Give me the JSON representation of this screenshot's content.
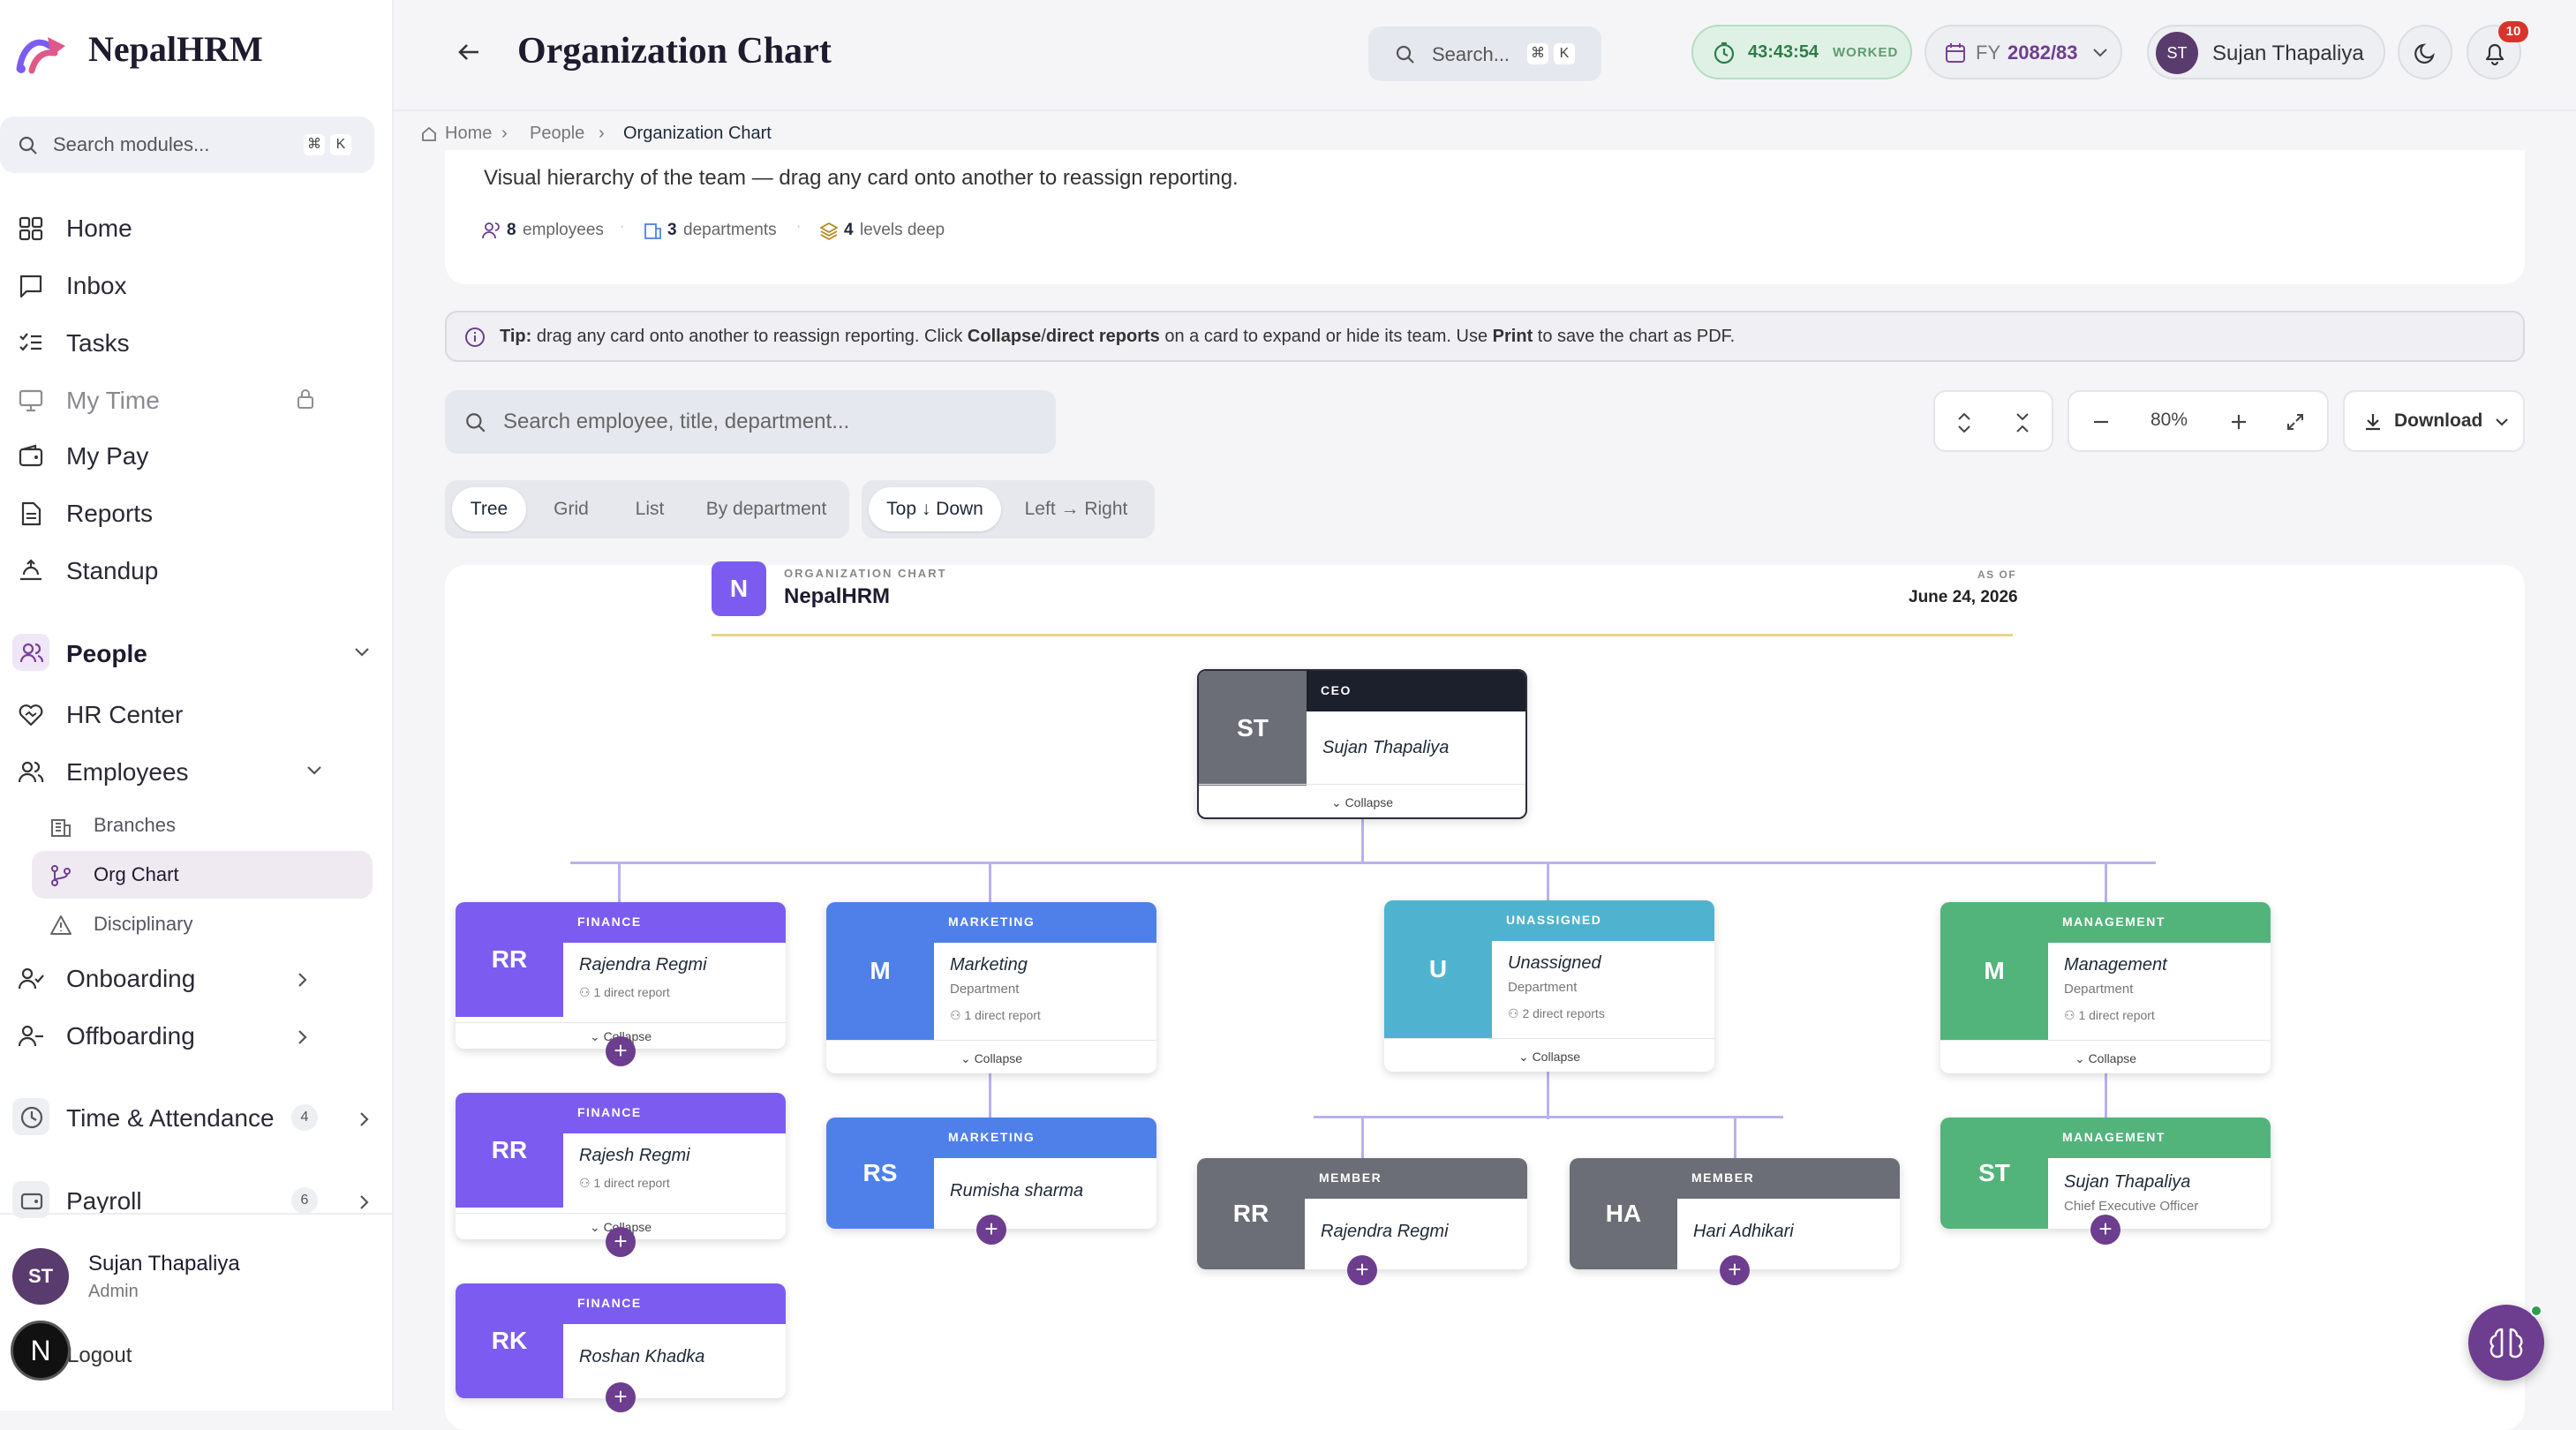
{
  "app": {
    "name": "NepalHRM"
  },
  "sidebar": {
    "search": {
      "placeholder": "Search modules...",
      "kbd1": "⌘",
      "kbd2": "K"
    },
    "items": [
      {
        "label": "Home"
      },
      {
        "label": "Inbox"
      },
      {
        "label": "Tasks"
      },
      {
        "label": "My Time"
      },
      {
        "label": "My Pay"
      },
      {
        "label": "Reports"
      },
      {
        "label": "Standup"
      },
      {
        "label": "People"
      },
      {
        "label": "HR Center"
      },
      {
        "label": "Employees"
      }
    ],
    "employees_sub": [
      {
        "label": "Branches"
      },
      {
        "label": "Org Chart"
      },
      {
        "label": "Disciplinary"
      }
    ],
    "onboarding": {
      "label": "Onboarding"
    },
    "offboarding": {
      "label": "Offboarding"
    },
    "time_attendance": {
      "label": "Time & Attendance",
      "count": "4"
    },
    "payroll": {
      "label": "Payroll",
      "count": "6"
    },
    "user": {
      "initials": "ST",
      "name": "Sujan Thapaliya",
      "role": "Admin"
    },
    "logout": {
      "label": "Logout",
      "avatar": "N"
    }
  },
  "header": {
    "title": "Organization Chart",
    "search": {
      "placeholder": "Search...",
      "kbd1": "⌘",
      "kbd2": "K"
    },
    "timer": {
      "value": "43:43:54",
      "label": "WORKED"
    },
    "fy": {
      "prefix": "FY",
      "value": "2082/83"
    },
    "user": {
      "initials": "ST",
      "name": "Sujan Thapaliya"
    },
    "notifications": {
      "count": "10"
    }
  },
  "breadcrumb": {
    "home": "Home",
    "people": "People",
    "current": "Organization Chart"
  },
  "summary": {
    "description": "Visual hierarchy of the team — drag any card onto another to reassign reporting.",
    "employees_count": "8",
    "employees_label": "employees",
    "departments_count": "3",
    "departments_label": "departments",
    "levels_count": "4",
    "levels_label": "levels deep"
  },
  "tip": {
    "lead": "Tip:",
    "t1": "drag any card onto another to reassign reporting. Click",
    "b1": "Collapse",
    "sep": "/",
    "b2": "direct reports",
    "t2": "on a card to expand or hide its team. Use",
    "b3": "Print",
    "t3": "to save the chart as PDF."
  },
  "controls": {
    "search_placeholder": "Search employee, title, department...",
    "view_tabs": [
      "Tree",
      "Grid",
      "List",
      "By department"
    ],
    "direction_tabs": [
      "Top ↓ Down",
      "Left → Right"
    ],
    "zoom": "80%",
    "download": "Download"
  },
  "chart_header": {
    "logo": "N",
    "eyebrow": "ORGANIZATION CHART",
    "org": "NepalHRM",
    "asof_label": "AS OF",
    "asof_date": "June 24, 2026"
  },
  "org": {
    "ceo": {
      "initials": "ST",
      "role": "CEO",
      "name": "Sujan Thapaliya",
      "collapse": "Collapse"
    },
    "finance1": {
      "initials": "RR",
      "dept": "FINANCE",
      "name": "Rajendra Regmi",
      "reports": "1 direct report",
      "collapse": "Collapse"
    },
    "finance2": {
      "initials": "RR",
      "dept": "FINANCE",
      "name": "Rajesh Regmi",
      "reports": "1 direct report",
      "collapse": "Collapse"
    },
    "finance3": {
      "initials": "RK",
      "dept": "FINANCE",
      "name": "Roshan Khadka"
    },
    "marketing": {
      "initials": "M",
      "dept": "MARKETING",
      "name": "Marketing",
      "sub": "Department",
      "reports": "1 direct report",
      "collapse": "Collapse"
    },
    "marketing1": {
      "initials": "RS",
      "dept": "MARKETING",
      "name": "Rumisha sharma"
    },
    "unassigned": {
      "initials": "U",
      "dept": "UNASSIGNED",
      "name": "Unassigned",
      "sub": "Department",
      "reports": "2 direct reports",
      "collapse": "Collapse"
    },
    "member1": {
      "initials": "RR",
      "dept": "MEMBER",
      "name": "Rajendra Regmi"
    },
    "member2": {
      "initials": "HA",
      "dept": "MEMBER",
      "name": "Hari Adhikari"
    },
    "management": {
      "initials": "M",
      "dept": "MANAGEMENT",
      "name": "Management",
      "sub": "Department",
      "reports": "1 direct report",
      "collapse": "Collapse"
    },
    "management1": {
      "initials": "ST",
      "dept": "MANAGEMENT",
      "name": "Sujan Thapaliya",
      "sub": "Chief Executive Officer"
    }
  },
  "colors": {
    "finance": "#7c5cf0",
    "marketing": "#4f80ea",
    "unassigned": "#4fb3cf",
    "management": "#52b47a",
    "member": "#6b6e76",
    "ceo": "#1c1f2c"
  }
}
